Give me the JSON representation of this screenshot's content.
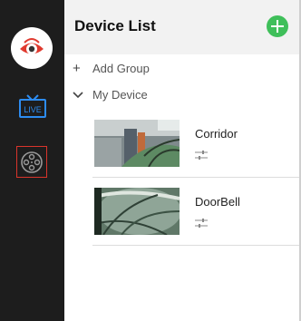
{
  "sidebar": {
    "logo_icon": "eye-logo-icon",
    "live_label": "LIVE",
    "live_icon": "tv-live-icon",
    "playback_icon": "film-reel-icon",
    "accent_color": "#d9342b"
  },
  "header": {
    "title": "Device List",
    "add_icon": "plus-circle-icon",
    "add_color": "#3fbf5a"
  },
  "tree": {
    "add_group": {
      "glyph": "+",
      "label": "Add Group"
    },
    "my_device": {
      "glyph": "⌄",
      "label": "My Device"
    }
  },
  "devices": [
    {
      "name": "Corridor",
      "settings_icon": "sliders-icon"
    },
    {
      "name": "DoorBell",
      "settings_icon": "sliders-icon"
    }
  ]
}
